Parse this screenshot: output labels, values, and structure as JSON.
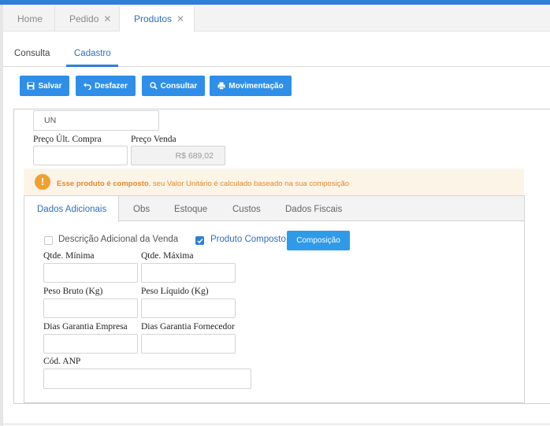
{
  "doc_tabs": [
    {
      "label": "Home"
    },
    {
      "label": "Pedido",
      "close": "✕"
    },
    {
      "label": "Produtos",
      "close": "✕"
    }
  ],
  "subtabs": {
    "consulta": "Consulta",
    "cadastro": "Cadastro"
  },
  "toolbar": {
    "salvar": "Salvar",
    "desfazer": "Desfazer",
    "consultar": "Consultar",
    "movimentacao": "Movimentação"
  },
  "form": {
    "unidade_value": "UN",
    "preco_ult_compra_label": "Preço Últ. Compra",
    "preco_ult_compra_value": "",
    "preco_venda_label": "Preço Venda",
    "preco_venda_value": "R$ 689,02"
  },
  "alert": {
    "icon": "!",
    "bold": "Esse produto é composto",
    "text": ", seu Valor Unitário é calculado baseado na sua composição"
  },
  "inner_tabs": [
    "Dados Adicionais",
    "Obs",
    "Estoque",
    "Custos",
    "Dados Fiscais"
  ],
  "dados_adicionais": {
    "descricao_adicional_label": "Descrição Adicional da Venda",
    "descricao_adicional_checked": false,
    "produto_composto_label": "Produto Composto",
    "produto_composto_checked": true,
    "composicao_button": "Composição",
    "qtde_minima_label": "Qtde. Mínima",
    "qtde_maxima_label": "Qtde. Máxima",
    "peso_bruto_label": "Peso Bruto (Kg)",
    "peso_liquido_label": "Peso Líquido (Kg)",
    "dias_garantia_empresa_label": "Dias Garantia Empresa",
    "dias_garantia_fornecedor_label": "Dias Garantia Fornecedor",
    "cod_anp_label": "Cód. ANP"
  },
  "colors": {
    "accent": "#2f7fd6",
    "button": "#2f8fe8",
    "alert_bg": "#fdf4e8",
    "alert_text": "#e08a2c"
  }
}
